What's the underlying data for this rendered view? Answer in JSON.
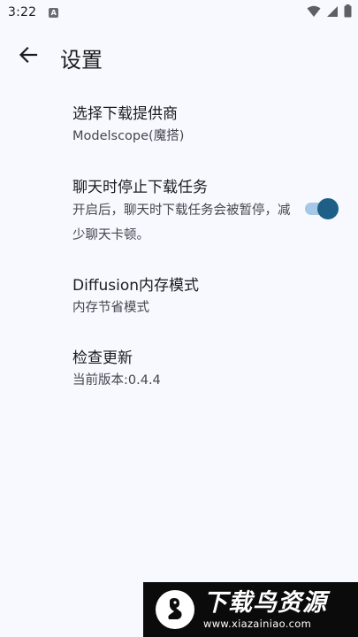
{
  "status_bar": {
    "time": "3:22",
    "notification_icon": "A",
    "icons": [
      "wifi-icon",
      "signal-icon",
      "battery-icon"
    ]
  },
  "app_bar": {
    "back_icon": "arrow-back-icon",
    "title": "设置"
  },
  "settings": [
    {
      "title": "选择下载提供商",
      "subtitle": "Modelscope(魔搭)"
    },
    {
      "title": "聊天时停止下载任务",
      "subtitle": "开启后，聊天时下载任务会被暂停，减少聊天卡顿。",
      "toggle_on": true
    },
    {
      "title": "Diffusion内存模式",
      "subtitle": "内存节省模式"
    },
    {
      "title": "检查更新",
      "subtitle": "当前版本:0.4.4"
    }
  ],
  "watermark": {
    "title": "下载鸟资源",
    "url": "www.xiazainiao.com"
  },
  "colors": {
    "background": "#f8f9ff",
    "toggle_thumb": "#1e5f87",
    "toggle_track": "#a5c8e6"
  }
}
